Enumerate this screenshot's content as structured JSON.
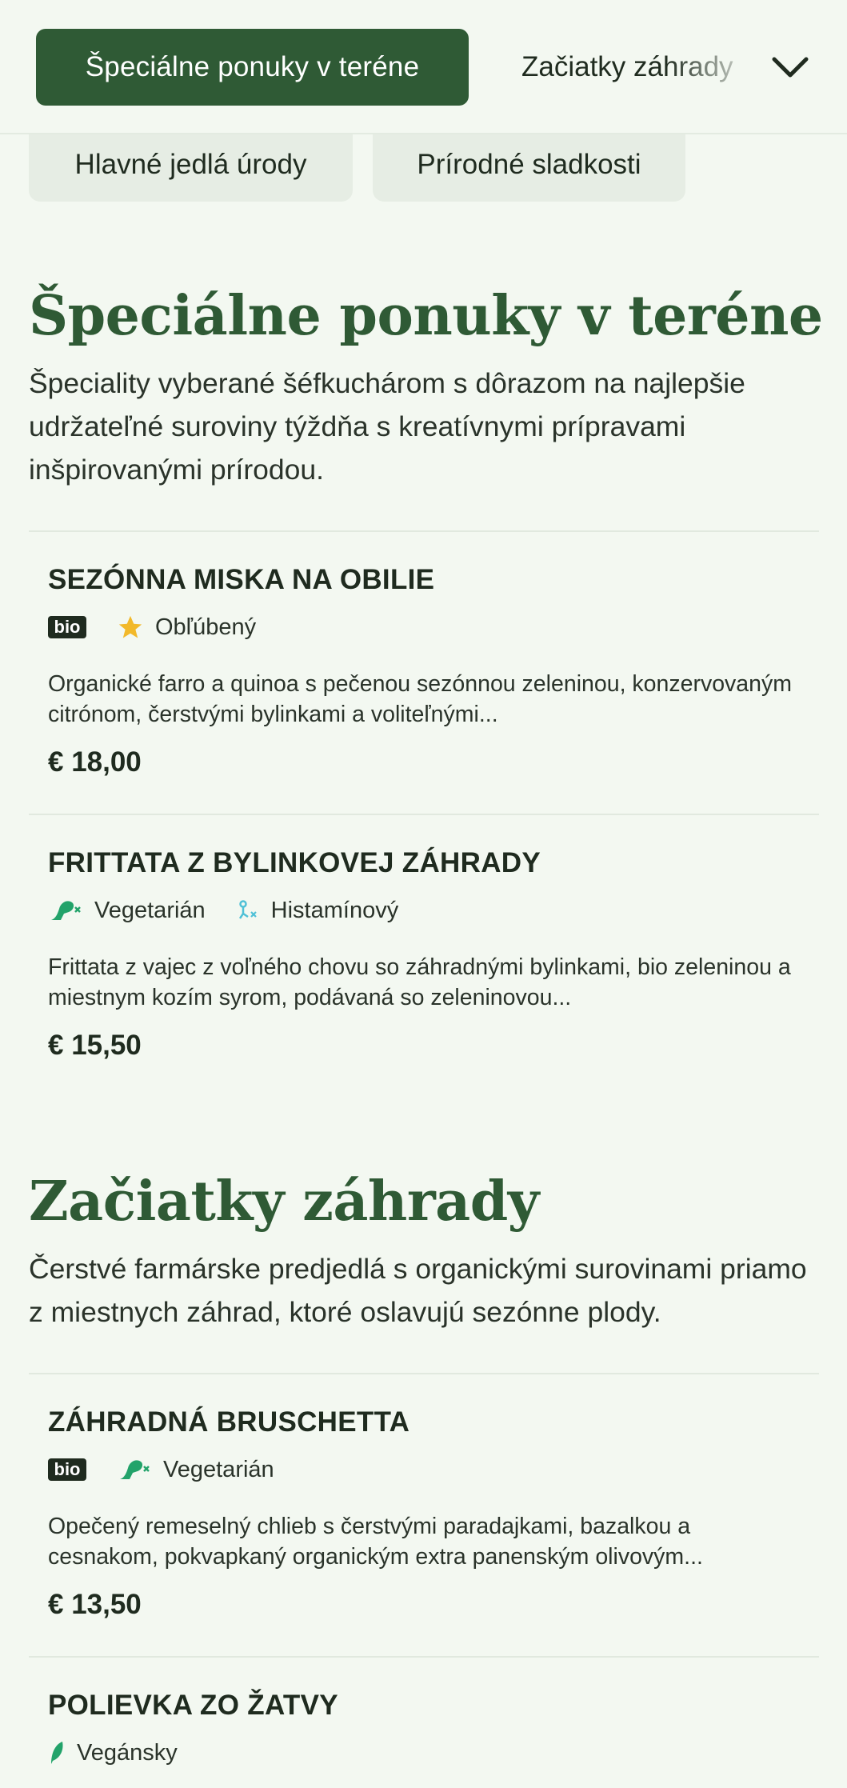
{
  "nav": {
    "active_tab": "Špeciálne ponuky v teréne",
    "next_tab": "Začiatky záhrady",
    "sub_tabs": [
      "Hlavné jedlá úrody",
      "Prírodné sladkosti"
    ]
  },
  "colors": {
    "accent": "#2f5a35",
    "background": "#f3f8f1",
    "star": "#f2b92a",
    "veg": "#22a36a",
    "histamine": "#4fc0d6"
  },
  "sections": [
    {
      "title": "Špeciálne ponuky v teréne",
      "description": "Špeciality vyberané šéfkuchárom s dôrazom na najlepšie udržateľné suroviny týždňa s kreatívnymi prípravami inšpirovanými prírodou.",
      "items": [
        {
          "name": "SEZÓNNA MISKA NA OBILIE",
          "tags": [
            {
              "type": "bio",
              "label": "bio"
            },
            {
              "type": "star-icon",
              "label": "Obľúbený"
            }
          ],
          "description": "Organické farro a quinoa s pečenou sezónnou zeleninou, konzervovaným citrónom, čerstvými bylinkami a voliteľnými...",
          "price": "€ 18,00"
        },
        {
          "name": "FRITTATA Z BYLINKOVEJ ZÁHRADY",
          "tags": [
            {
              "type": "vegetarian-icon",
              "label": "Vegetarián"
            },
            {
              "type": "histamine-icon",
              "label": "Histamínový"
            }
          ],
          "description": "Frittata z vajec z voľného chovu so záhradnými bylinkami, bio zeleninou a miestnym kozím syrom, podávaná so zeleninovou...",
          "price": "€ 15,50"
        }
      ]
    },
    {
      "title": "Začiatky záhrady",
      "description": "Čerstvé farmárske predjedlá s organickými surovinami priamo z miestnych záhrad, ktoré oslavujú sezónne plody.",
      "items": [
        {
          "name": "ZÁHRADNÁ BRUSCHETTA",
          "tags": [
            {
              "type": "bio",
              "label": "bio"
            },
            {
              "type": "vegetarian-icon",
              "label": "Vegetarián"
            }
          ],
          "description": "Opečený remeselný chlieb s čerstvými paradajkami, bazalkou a cesnakom, pokvapkaný organickým extra panenským olivovým...",
          "price": "€ 13,50"
        },
        {
          "name": "POLIEVKA ZO ŽATVY",
          "tags": [
            {
              "type": "vegan-leaf-icon",
              "label": "Vegánsky"
            }
          ]
        }
      ]
    }
  ]
}
